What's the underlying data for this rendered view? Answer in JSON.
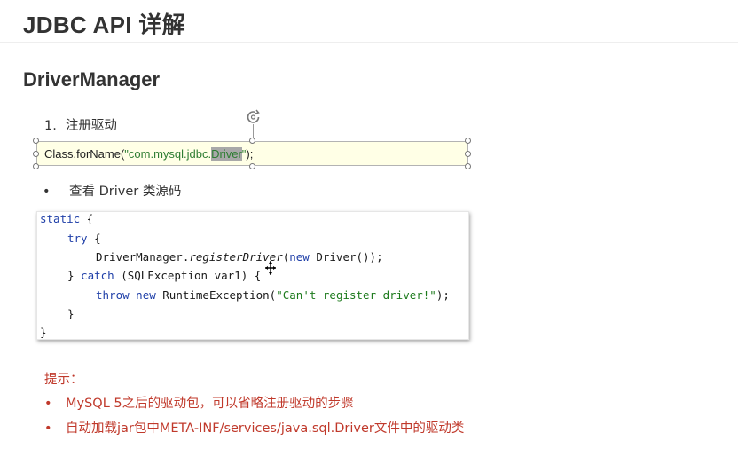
{
  "slide": {
    "title": "JDBC API 详解",
    "section": "DriverManager",
    "step_number": "1.",
    "step_text": "注册驱动",
    "code_line": {
      "prefix": "Class.forName(",
      "string_part": "\"com.mysql.jdbc.",
      "highlighted": "Driver",
      "string_end": "\"",
      "suffix": ");"
    },
    "bullet_text": "查看 Driver 类源码",
    "source_code": {
      "l1_kw": "static",
      "l1_rest": " {",
      "l2_kw": "try",
      "l2_rest": " {",
      "l3_a": "DriverManager.",
      "l3_method": "registerDriver",
      "l3_b": "(",
      "l3_kw": "new",
      "l3_c": " Driver());",
      "l4_a": "} ",
      "l4_kw": "catch",
      "l4_b": " (SQLException var1) {",
      "l5_kw1": "throw",
      "l5_sp": " ",
      "l5_kw2": "new",
      "l5_a": " RuntimeException(",
      "l5_str": "\"Can't register driver!\"",
      "l5_b": ");",
      "l6": "}",
      "l7": "}"
    },
    "tips_title": "提示：",
    "tips": [
      "MySQL 5之后的驱动包，可以省略注册驱动的步骤",
      "自动加载jar包中META-INF/services/java.sql.Driver文件中的驱动类"
    ],
    "bullet_symbol": "•"
  },
  "colors": {
    "title": "#333333",
    "tip": "#c0392b",
    "keyword": "#1f3fa8",
    "string": "#1c7a1c",
    "selection_fill": "#ffffe6"
  },
  "icons": [
    "rotate-handle-icon",
    "move-cursor-icon"
  ]
}
